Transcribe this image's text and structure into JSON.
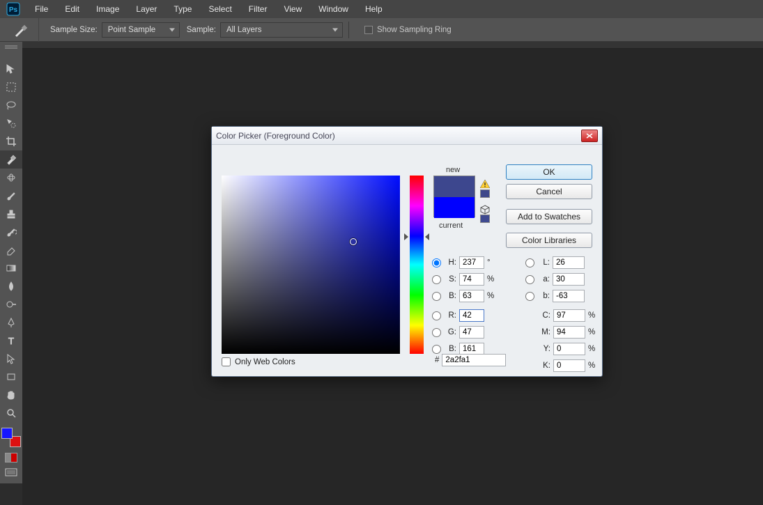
{
  "menubar": {
    "items": [
      "File",
      "Edit",
      "Image",
      "Layer",
      "Type",
      "Select",
      "Filter",
      "View",
      "Window",
      "Help"
    ]
  },
  "optionsbar": {
    "sample_size_label": "Sample Size:",
    "sample_size_value": "Point Sample",
    "sample_label": "Sample:",
    "sample_value": "All Layers",
    "show_ring_label": "Show Sampling Ring"
  },
  "dialog": {
    "title": "Color Picker (Foreground Color)",
    "new_label": "new",
    "current_label": "current",
    "new_color": "#3d478e",
    "current_color": "#0000ff",
    "buttons": {
      "ok": "OK",
      "cancel": "Cancel",
      "add_swatch": "Add to Swatches",
      "color_libs": "Color Libraries"
    },
    "values": {
      "H": "237",
      "S": "74",
      "Bv": "63",
      "R": "42",
      "G": "47",
      "Bb": "161",
      "L": "26",
      "a": "30",
      "b": "-63",
      "C": "97",
      "M": "94",
      "Y": "0",
      "K": "0",
      "hex": "2a2fa1"
    },
    "labels": {
      "H": "H:",
      "S": "S:",
      "Bv": "B:",
      "R": "R:",
      "G": "G:",
      "Bb": "B:",
      "L": "L:",
      "a": "a:",
      "b": "b:",
      "C": "C:",
      "M": "M:",
      "Y": "Y:",
      "K": "K:",
      "deg": "°",
      "pct": "%",
      "hash": "#"
    },
    "only_web": "Only Web Colors"
  }
}
